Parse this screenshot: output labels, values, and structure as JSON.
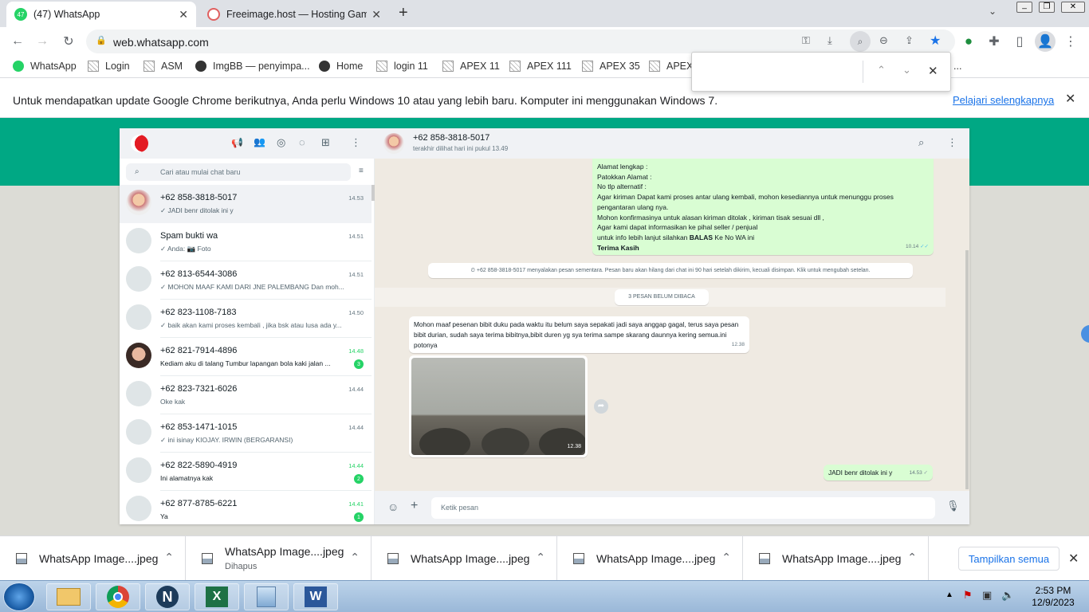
{
  "browser": {
    "tabs": [
      {
        "badge": "47",
        "title": "(47) WhatsApp",
        "active": true
      },
      {
        "title": "Freeimage.host — Hosting Gamb",
        "active": false
      }
    ],
    "url": "web.whatsapp.com",
    "bookmarks": [
      "WhatsApp",
      "Login",
      "ASM",
      "ImgBB — penyimpa...",
      "Home",
      "login 11",
      "APEX 11",
      "APEX 111",
      "APEX 35",
      "APEX"
    ],
    "bookmarks_overflow": "...",
    "infobar": {
      "text": "Untuk mendapatkan update Google Chrome berikutnya, Anda perlu Windows 10 atau yang lebih baru. Komputer ini menggunakan Windows 7.",
      "link": "Pelajari selengkapnya"
    }
  },
  "whatsapp": {
    "search_placeholder": "Cari atau mulai chat baru",
    "chats": [
      {
        "name": "+62 858-3818-5017",
        "time": "14.53",
        "preview": "✓ JADI benr ditolak ini y",
        "unread": null,
        "selected": true
      },
      {
        "name": "Spam bukti wa",
        "time": "14.51",
        "preview": "✓ Anda: 📷 Foto",
        "unread": null
      },
      {
        "name": "+62 813-6544-3086",
        "time": "14.51",
        "preview": "✓ MOHON MAAF KAMI DARI JNE PALEMBANG   Dan moh...",
        "unread": null
      },
      {
        "name": "+62 823-1108-7183",
        "time": "14.50",
        "preview": "✓ baik akan kami proses kembali , jika bsk atau lusa ada  y...",
        "unread": null
      },
      {
        "name": "+62 821-7914-4896",
        "time": "14.48",
        "preview": "Kediam aku di talang Tumbur lapangan bola kaki jalan ...",
        "unread": "3"
      },
      {
        "name": "+62 823-7321-6026",
        "time": "14.44",
        "preview": "Oke kak",
        "unread": null
      },
      {
        "name": "+62 853-1471-1015",
        "time": "14.44",
        "preview": "✓ ini isinay KIOJAY. IRWIN (BERGARANSI)",
        "unread": null
      },
      {
        "name": "+62 822-5890-4919",
        "time": "14.44",
        "preview": "Ini alamatnya kak",
        "unread": "2"
      },
      {
        "name": "+62 877-8785-6221",
        "time": "14.41",
        "preview": "Ya",
        "unread": "1"
      }
    ],
    "contact": {
      "name": "+62 858-3818-5017",
      "status": "terakhir dilihat hari ini pukul 13.49"
    },
    "outgoing_template": {
      "lines": [
        "Alamat  lengkap :",
        "Patokkan Alamat :",
        "No tlp alternatif :",
        "Agar kiriman Dapat kami proses antar ulang kembali, mohon kesediannya untuk menunggu proses pengantaran ulang nya.",
        "Mohon konfirmasinya untuk alasan kiriman ditolak , kiriman tisak sesuai dll ,",
        "Agar kami dapat informasikan ke pihal seller / penjual"
      ],
      "line_balas_prefix": "untuk info lebih lanjut silahkan ",
      "line_balas_bold": "BALAS",
      "line_balas_suffix": " Ke No WA ini",
      "closing": "Terima Kasih",
      "time": "10.14"
    },
    "system_notice": "+62 858-3818-5017 menyalakan pesan sementara. Pesan baru akan hilang dari chat ini 90 hari setelah dikirim, kecuali disimpan. Klik untuk mengubah setelan.",
    "unread_divider": "3 PESAN BELUM DIBACA",
    "incoming_text": {
      "text": "Mohon maaf pesenan bibit duku pada waktu itu belum saya sepakati jadi saya anggap gagal, terus saya pesan bibit durian, sudah  saya terima bibitnya,bibit duren yg sya terima sampe skarang daunnya kering semua.ini potonya",
      "time": "12.38"
    },
    "incoming_image": {
      "time": "12.38"
    },
    "last_outgoing": {
      "text": "JADI benr ditolak ini y",
      "time": "14.53"
    },
    "input_placeholder": "Ketik pesan"
  },
  "downloads": {
    "items": [
      {
        "name": "WhatsApp Image....jpeg",
        "sub": ""
      },
      {
        "name": "WhatsApp Image....jpeg",
        "sub": "Dihapus"
      },
      {
        "name": "WhatsApp Image....jpeg",
        "sub": ""
      },
      {
        "name": "WhatsApp Image....jpeg",
        "sub": ""
      },
      {
        "name": "WhatsApp Image....jpeg",
        "sub": ""
      }
    ],
    "show_all": "Tampilkan semua"
  },
  "taskbar": {
    "time": "2:53 PM",
    "date": "12/9/2023"
  }
}
